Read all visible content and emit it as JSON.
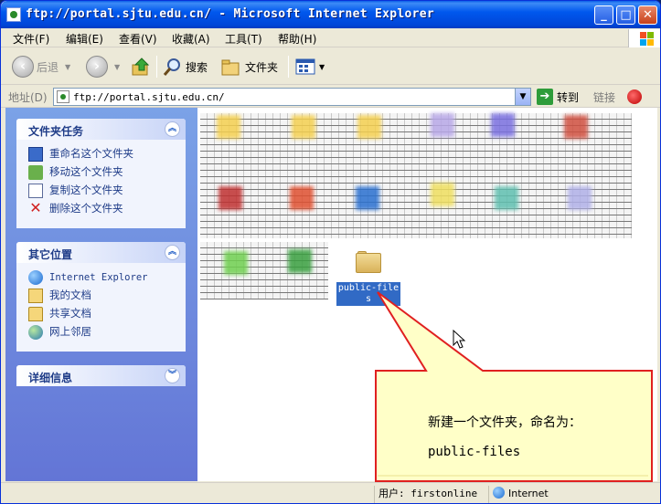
{
  "window": {
    "title": "ftp://portal.sjtu.edu.cn/ - Microsoft Internet Explorer",
    "min_glyph": "_",
    "max_glyph": "□",
    "close_glyph": "✕"
  },
  "menu": [
    "文件(F)",
    "编辑(E)",
    "查看(V)",
    "收藏(A)",
    "工具(T)",
    "帮助(H)"
  ],
  "toolbar": {
    "back_label": "后退",
    "search_label": "搜索",
    "folders_label": "文件夹"
  },
  "address": {
    "label": "地址(D)",
    "value": "ftp://portal.sjtu.edu.cn/",
    "go_label": "转到",
    "links_label": "链接"
  },
  "sidebar": {
    "folder_tasks": {
      "title": "文件夹任务",
      "items": [
        "重命名这个文件夹",
        "移动这个文件夹",
        "复制这个文件夹",
        "删除这个文件夹"
      ]
    },
    "other_places": {
      "title": "其它位置",
      "items": [
        "Internet Explorer",
        "我的文档",
        "共享文档",
        "网上邻居"
      ]
    },
    "details": {
      "title": "详细信息"
    }
  },
  "folder": {
    "name": "public-files"
  },
  "callout": {
    "line1": "新建一个文件夹，命名为：",
    "line2": "public-files"
  },
  "status": {
    "user": "用户: firstonline",
    "zone": "Internet"
  },
  "colors": {
    "title_blue": "#0058ee",
    "selection": "#316ac5",
    "callout_fill": "#ffffc8",
    "callout_border": "#e02020"
  }
}
